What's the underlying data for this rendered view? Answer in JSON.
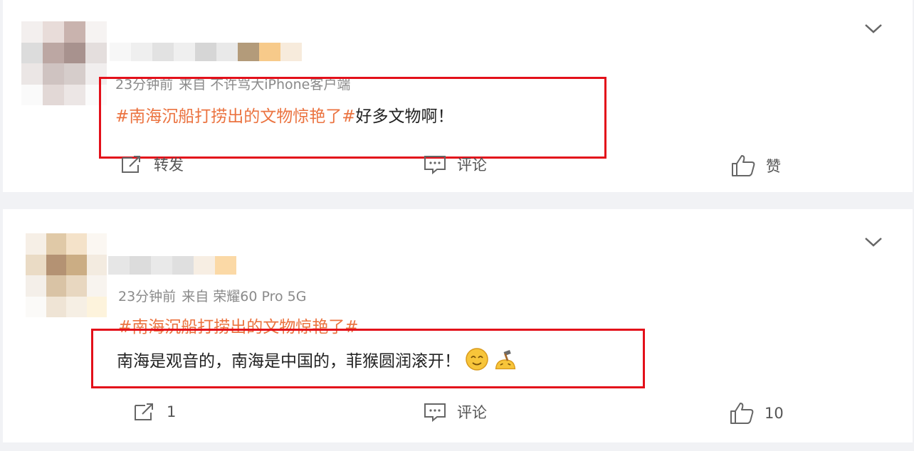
{
  "posts": [
    {
      "meta": {
        "time": "23分钟前",
        "source": "来自 不许骂大iPhone客户端"
      },
      "topic": "#南海沉船打捞出的文物惊艳了#",
      "text": "好多文物啊！",
      "actions": {
        "repost": "转发",
        "comment": "评论",
        "like": "赞"
      }
    },
    {
      "meta": {
        "time": "23分钟前",
        "source": "来自 荣耀60 Pro 5G"
      },
      "topic": "#南海沉船打捞出的文物惊艳了#",
      "text": "南海是观音的，南海是中国的，菲猴圆润滚开！",
      "actions": {
        "repost": "1",
        "comment": "评论",
        "like": "10"
      }
    }
  ],
  "emojis": [
    "doge-emoji",
    "hammer-emoji"
  ],
  "colors": {
    "topic": "#eb7340",
    "highlight_box": "#e3101a",
    "background": "#f1f2f5"
  }
}
